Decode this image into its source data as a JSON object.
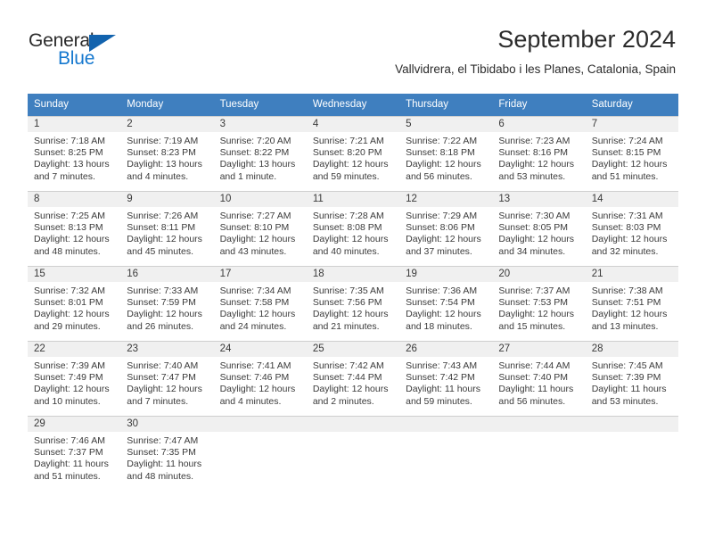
{
  "brand": {
    "name_part1": "General",
    "name_part2": "Blue",
    "triangle_icon": "triangle-icon",
    "accent_color": "#1578cf",
    "header_color": "#3f7fbf"
  },
  "header": {
    "title": "September 2024",
    "subtitle": "Vallvidrera, el Tibidabo i les Planes, Catalonia, Spain"
  },
  "calendar": {
    "weekdays": [
      "Sunday",
      "Monday",
      "Tuesday",
      "Wednesday",
      "Thursday",
      "Friday",
      "Saturday"
    ],
    "weeks": [
      [
        {
          "day": "1",
          "sunrise": "Sunrise: 7:18 AM",
          "sunset": "Sunset: 8:25 PM",
          "daylight1": "Daylight: 13 hours",
          "daylight2": "and 7 minutes."
        },
        {
          "day": "2",
          "sunrise": "Sunrise: 7:19 AM",
          "sunset": "Sunset: 8:23 PM",
          "daylight1": "Daylight: 13 hours",
          "daylight2": "and 4 minutes."
        },
        {
          "day": "3",
          "sunrise": "Sunrise: 7:20 AM",
          "sunset": "Sunset: 8:22 PM",
          "daylight1": "Daylight: 13 hours",
          "daylight2": "and 1 minute."
        },
        {
          "day": "4",
          "sunrise": "Sunrise: 7:21 AM",
          "sunset": "Sunset: 8:20 PM",
          "daylight1": "Daylight: 12 hours",
          "daylight2": "and 59 minutes."
        },
        {
          "day": "5",
          "sunrise": "Sunrise: 7:22 AM",
          "sunset": "Sunset: 8:18 PM",
          "daylight1": "Daylight: 12 hours",
          "daylight2": "and 56 minutes."
        },
        {
          "day": "6",
          "sunrise": "Sunrise: 7:23 AM",
          "sunset": "Sunset: 8:16 PM",
          "daylight1": "Daylight: 12 hours",
          "daylight2": "and 53 minutes."
        },
        {
          "day": "7",
          "sunrise": "Sunrise: 7:24 AM",
          "sunset": "Sunset: 8:15 PM",
          "daylight1": "Daylight: 12 hours",
          "daylight2": "and 51 minutes."
        }
      ],
      [
        {
          "day": "8",
          "sunrise": "Sunrise: 7:25 AM",
          "sunset": "Sunset: 8:13 PM",
          "daylight1": "Daylight: 12 hours",
          "daylight2": "and 48 minutes."
        },
        {
          "day": "9",
          "sunrise": "Sunrise: 7:26 AM",
          "sunset": "Sunset: 8:11 PM",
          "daylight1": "Daylight: 12 hours",
          "daylight2": "and 45 minutes."
        },
        {
          "day": "10",
          "sunrise": "Sunrise: 7:27 AM",
          "sunset": "Sunset: 8:10 PM",
          "daylight1": "Daylight: 12 hours",
          "daylight2": "and 43 minutes."
        },
        {
          "day": "11",
          "sunrise": "Sunrise: 7:28 AM",
          "sunset": "Sunset: 8:08 PM",
          "daylight1": "Daylight: 12 hours",
          "daylight2": "and 40 minutes."
        },
        {
          "day": "12",
          "sunrise": "Sunrise: 7:29 AM",
          "sunset": "Sunset: 8:06 PM",
          "daylight1": "Daylight: 12 hours",
          "daylight2": "and 37 minutes."
        },
        {
          "day": "13",
          "sunrise": "Sunrise: 7:30 AM",
          "sunset": "Sunset: 8:05 PM",
          "daylight1": "Daylight: 12 hours",
          "daylight2": "and 34 minutes."
        },
        {
          "day": "14",
          "sunrise": "Sunrise: 7:31 AM",
          "sunset": "Sunset: 8:03 PM",
          "daylight1": "Daylight: 12 hours",
          "daylight2": "and 32 minutes."
        }
      ],
      [
        {
          "day": "15",
          "sunrise": "Sunrise: 7:32 AM",
          "sunset": "Sunset: 8:01 PM",
          "daylight1": "Daylight: 12 hours",
          "daylight2": "and 29 minutes."
        },
        {
          "day": "16",
          "sunrise": "Sunrise: 7:33 AM",
          "sunset": "Sunset: 7:59 PM",
          "daylight1": "Daylight: 12 hours",
          "daylight2": "and 26 minutes."
        },
        {
          "day": "17",
          "sunrise": "Sunrise: 7:34 AM",
          "sunset": "Sunset: 7:58 PM",
          "daylight1": "Daylight: 12 hours",
          "daylight2": "and 24 minutes."
        },
        {
          "day": "18",
          "sunrise": "Sunrise: 7:35 AM",
          "sunset": "Sunset: 7:56 PM",
          "daylight1": "Daylight: 12 hours",
          "daylight2": "and 21 minutes."
        },
        {
          "day": "19",
          "sunrise": "Sunrise: 7:36 AM",
          "sunset": "Sunset: 7:54 PM",
          "daylight1": "Daylight: 12 hours",
          "daylight2": "and 18 minutes."
        },
        {
          "day": "20",
          "sunrise": "Sunrise: 7:37 AM",
          "sunset": "Sunset: 7:53 PM",
          "daylight1": "Daylight: 12 hours",
          "daylight2": "and 15 minutes."
        },
        {
          "day": "21",
          "sunrise": "Sunrise: 7:38 AM",
          "sunset": "Sunset: 7:51 PM",
          "daylight1": "Daylight: 12 hours",
          "daylight2": "and 13 minutes."
        }
      ],
      [
        {
          "day": "22",
          "sunrise": "Sunrise: 7:39 AM",
          "sunset": "Sunset: 7:49 PM",
          "daylight1": "Daylight: 12 hours",
          "daylight2": "and 10 minutes."
        },
        {
          "day": "23",
          "sunrise": "Sunrise: 7:40 AM",
          "sunset": "Sunset: 7:47 PM",
          "daylight1": "Daylight: 12 hours",
          "daylight2": "and 7 minutes."
        },
        {
          "day": "24",
          "sunrise": "Sunrise: 7:41 AM",
          "sunset": "Sunset: 7:46 PM",
          "daylight1": "Daylight: 12 hours",
          "daylight2": "and 4 minutes."
        },
        {
          "day": "25",
          "sunrise": "Sunrise: 7:42 AM",
          "sunset": "Sunset: 7:44 PM",
          "daylight1": "Daylight: 12 hours",
          "daylight2": "and 2 minutes."
        },
        {
          "day": "26",
          "sunrise": "Sunrise: 7:43 AM",
          "sunset": "Sunset: 7:42 PM",
          "daylight1": "Daylight: 11 hours",
          "daylight2": "and 59 minutes."
        },
        {
          "day": "27",
          "sunrise": "Sunrise: 7:44 AM",
          "sunset": "Sunset: 7:40 PM",
          "daylight1": "Daylight: 11 hours",
          "daylight2": "and 56 minutes."
        },
        {
          "day": "28",
          "sunrise": "Sunrise: 7:45 AM",
          "sunset": "Sunset: 7:39 PM",
          "daylight1": "Daylight: 11 hours",
          "daylight2": "and 53 minutes."
        }
      ],
      [
        {
          "day": "29",
          "sunrise": "Sunrise: 7:46 AM",
          "sunset": "Sunset: 7:37 PM",
          "daylight1": "Daylight: 11 hours",
          "daylight2": "and 51 minutes."
        },
        {
          "day": "30",
          "sunrise": "Sunrise: 7:47 AM",
          "sunset": "Sunset: 7:35 PM",
          "daylight1": "Daylight: 11 hours",
          "daylight2": "and 48 minutes."
        },
        {
          "day": "",
          "sunrise": "",
          "sunset": "",
          "daylight1": "",
          "daylight2": ""
        },
        {
          "day": "",
          "sunrise": "",
          "sunset": "",
          "daylight1": "",
          "daylight2": ""
        },
        {
          "day": "",
          "sunrise": "",
          "sunset": "",
          "daylight1": "",
          "daylight2": ""
        },
        {
          "day": "",
          "sunrise": "",
          "sunset": "",
          "daylight1": "",
          "daylight2": ""
        },
        {
          "day": "",
          "sunrise": "",
          "sunset": "",
          "daylight1": "",
          "daylight2": ""
        }
      ]
    ]
  }
}
